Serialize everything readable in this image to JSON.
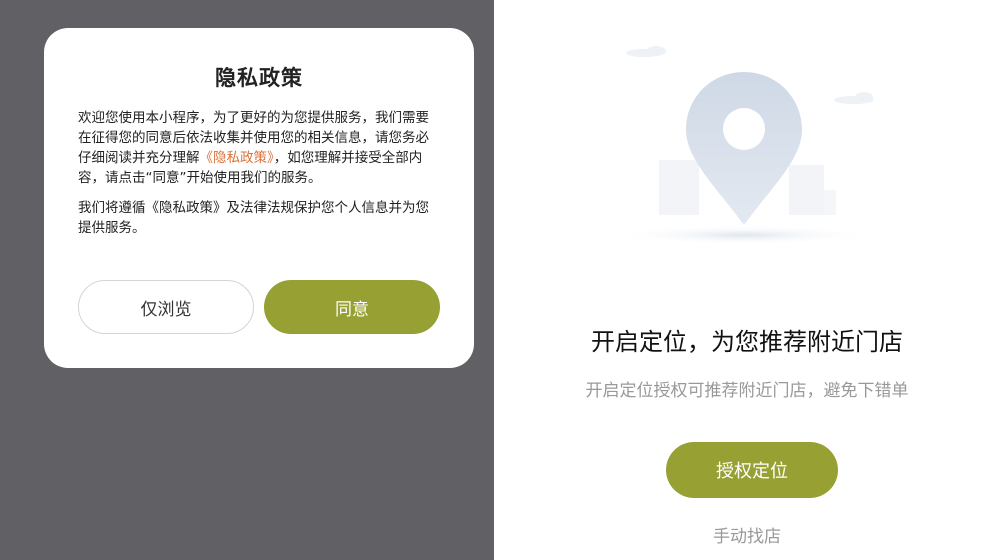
{
  "privacy_dialog": {
    "title": "隐私政策",
    "paragraph1_before": "欢迎您使用本小程序，为了更好的为您提供服务，我们需要在征得您的同意后依法收集并使用您的相关信息，请您务必仔细阅读并充分理解",
    "paragraph1_link": "《隐私政策》",
    "paragraph1_after": "，如您理解并接受全部内容，请点击“同意”开始使用我们的服务。",
    "paragraph2": "我们将遵循《隐私政策》及法律法规保护您个人信息并为您提供服务。",
    "browse_button": "仅浏览",
    "agree_button": "同意"
  },
  "location_page": {
    "title": "开启定位，为您推荐附近门店",
    "subtitle": "开启定位授权可推荐附近门店，避免下错单",
    "authorize_button": "授权定位",
    "manual_link": "手动找店",
    "illustration_icon": "location-pin-icon"
  },
  "colors": {
    "accent": "#97a033",
    "overlay": "#616064",
    "link": "#d9733a",
    "muted_text": "#999999"
  }
}
